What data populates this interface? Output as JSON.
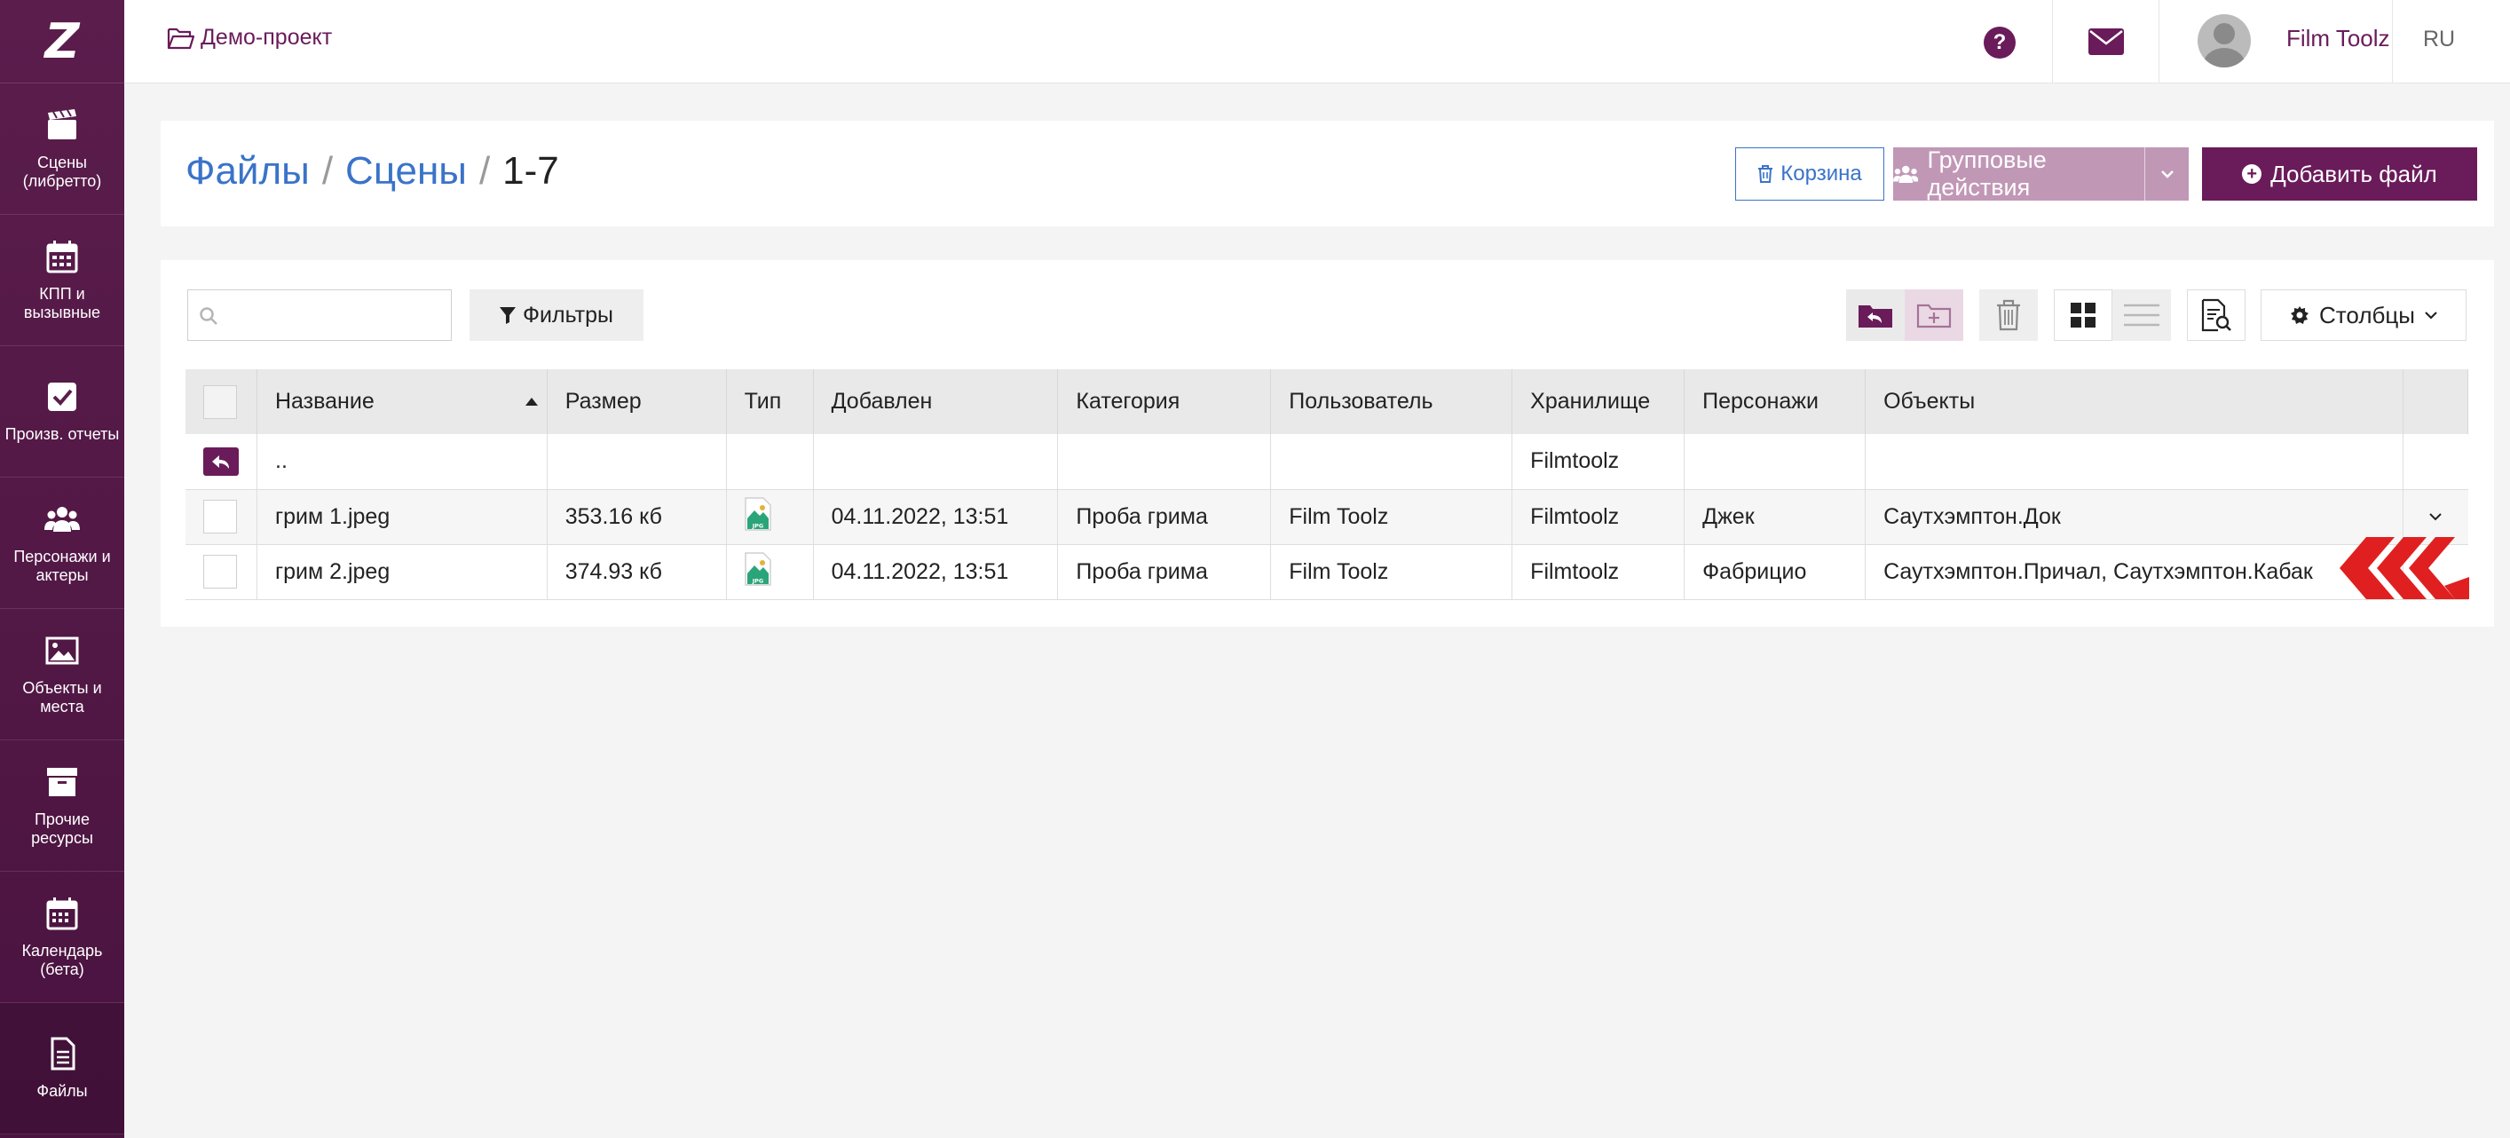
{
  "colors": {
    "brand": "#6a1b5a",
    "link": "#3a73c9",
    "accent_red": "#e02020"
  },
  "sidebar": {
    "logo": "Z",
    "items": [
      {
        "label": "Сцены (либретто)",
        "icon": "clapperboard-icon"
      },
      {
        "label": "КПП и вызывные",
        "icon": "calendar-icon"
      },
      {
        "label": "Произв. отчеты",
        "icon": "checkbox-icon"
      },
      {
        "label": "Персонажи и актеры",
        "icon": "users-icon"
      },
      {
        "label": "Объекты и места",
        "icon": "image-icon"
      },
      {
        "label": "Прочие ресурсы",
        "icon": "archive-icon"
      },
      {
        "label": "Календарь (бета)",
        "icon": "calendar-grid-icon"
      },
      {
        "label": "Файлы",
        "icon": "file-icon"
      }
    ]
  },
  "topbar": {
    "project": "Демо-проект",
    "user_name": "Film Toolz",
    "lang": "RU"
  },
  "header": {
    "breadcrumb": [
      "Файлы",
      "Сцены",
      "1-7"
    ],
    "separator": "/",
    "trash_label": "Корзина",
    "group_actions_label": "Групповые действия",
    "add_file_label": "Добавить файл"
  },
  "toolbar": {
    "search_value": "",
    "filter_label": "Фильтры",
    "columns_label": "Столбцы"
  },
  "table": {
    "headers": [
      "Название",
      "Размер",
      "Тип",
      "Добавлен",
      "Категория",
      "Пользователь",
      "Хранилище",
      "Персонажи",
      "Объекты"
    ],
    "parent_row": {
      "name": "..",
      "storage": "Filmtoolz"
    },
    "rows": [
      {
        "name": "грим 1.jpeg",
        "size": "353.16 кб",
        "type": "JPG",
        "added": "04.11.2022, 13:51",
        "category": "Проба грима",
        "user": "Film Toolz",
        "storage": "Filmtoolz",
        "characters": "Джек",
        "objects": "Саутхэмптон.Док"
      },
      {
        "name": "грим 2.jpeg",
        "size": "374.93 кб",
        "type": "JPG",
        "added": "04.11.2022, 13:51",
        "category": "Проба грима",
        "user": "Film Toolz",
        "storage": "Filmtoolz",
        "characters": "Фабрицио",
        "objects": "Саутхэмптон.Причал, Саутхэмптон.Кабак"
      }
    ]
  }
}
